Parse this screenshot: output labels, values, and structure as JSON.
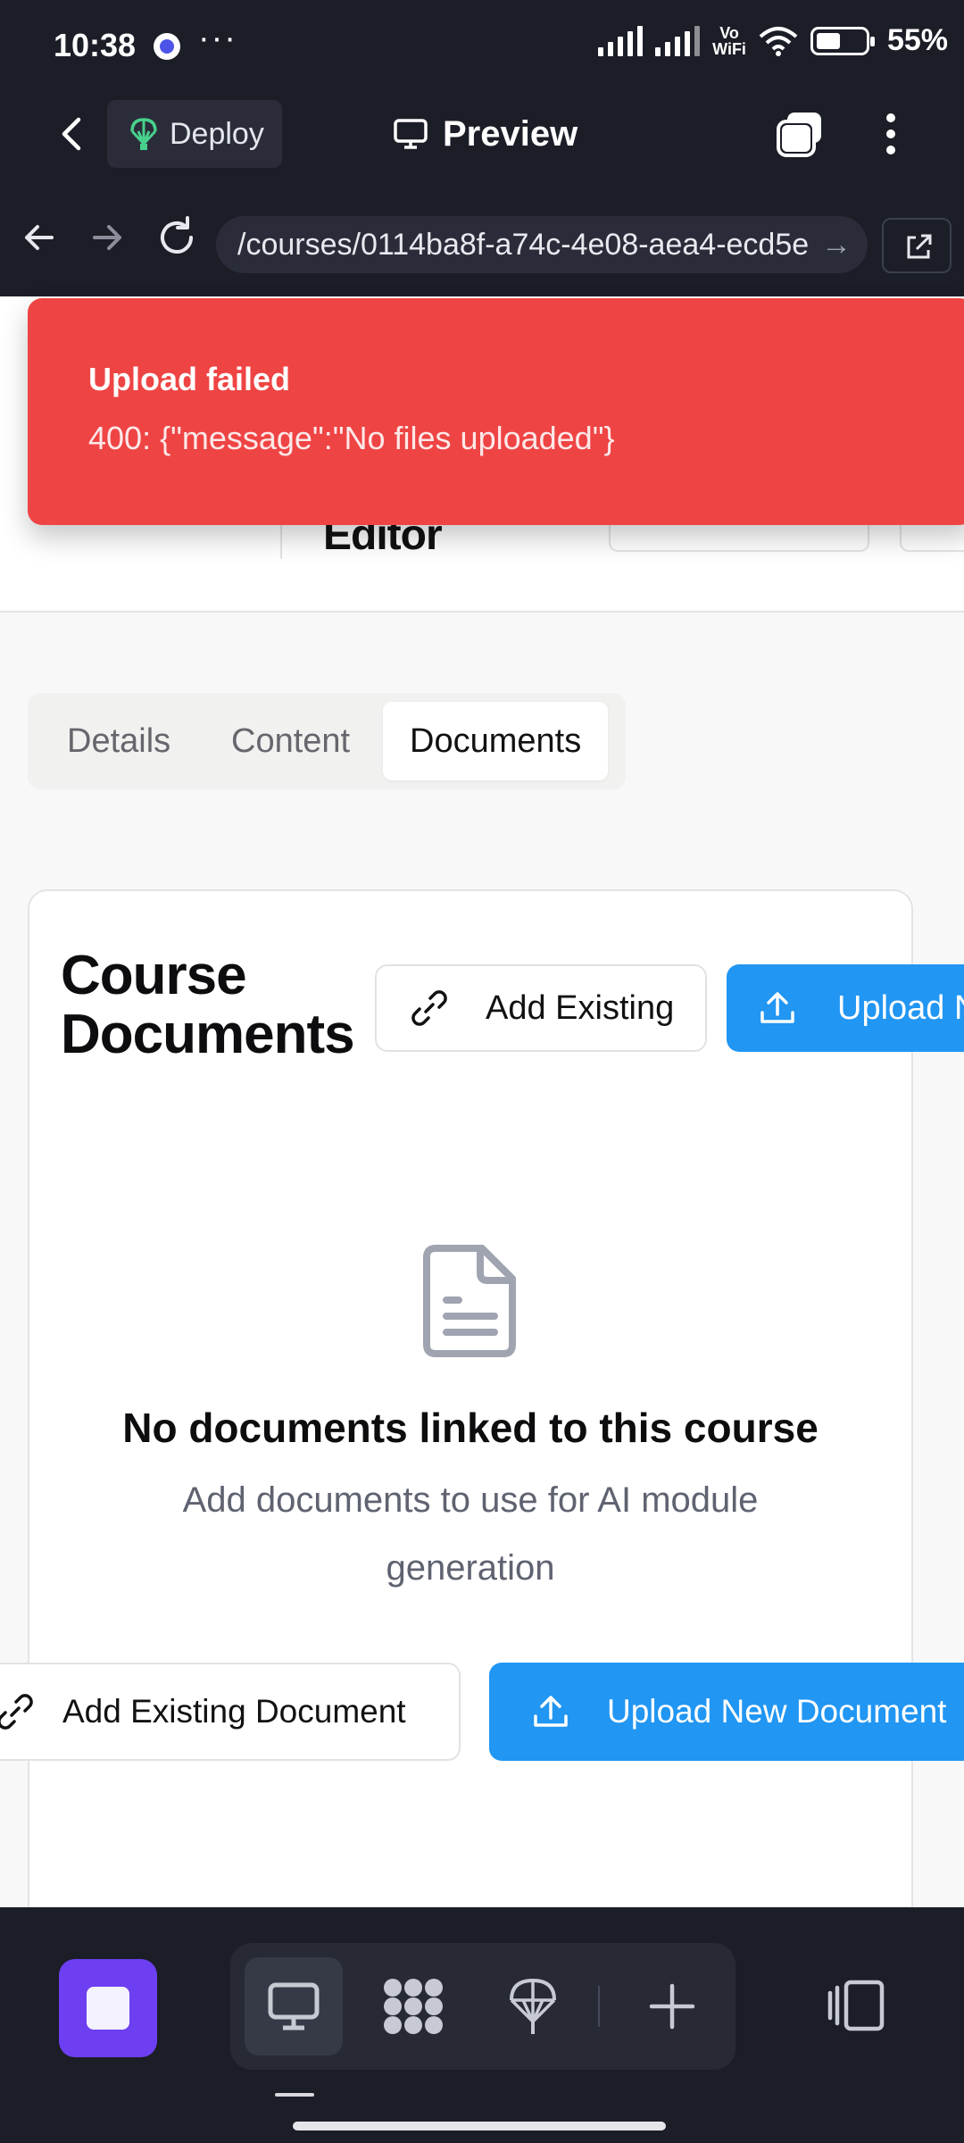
{
  "status_bar": {
    "time": "10:38",
    "overflow": "···",
    "network_label": "Vo\nWiFi",
    "battery": "55%"
  },
  "app_header": {
    "deploy_label": "Deploy",
    "preview_label": "Preview"
  },
  "browser": {
    "url": "/courses/0114ba8f-a74c-4e08-aea4-ecd5e",
    "url_arrow": "→"
  },
  "page": {
    "editor_title": "Editor",
    "tabs": [
      {
        "label": "Details",
        "active": false
      },
      {
        "label": "Content",
        "active": false
      },
      {
        "label": "Documents",
        "active": true
      }
    ],
    "card": {
      "title_line1": "Course",
      "title_line2": "Documents",
      "add_existing_label": "Add Existing",
      "upload_new_label": "Upload New",
      "empty_title": "No documents linked to this course",
      "empty_subtitle": "Add documents to use for AI module generation",
      "add_existing_document_label": "Add Existing Document",
      "upload_new_document_label": "Upload New Document"
    }
  },
  "toast": {
    "title": "Upload failed",
    "message": "400: {\"message\":\"No files uploaded\"}",
    "color": "#ef4444"
  },
  "colors": {
    "primary": "#2196f3",
    "dark_chrome": "#1b1d27",
    "stop_button": "#6d3ff0"
  }
}
